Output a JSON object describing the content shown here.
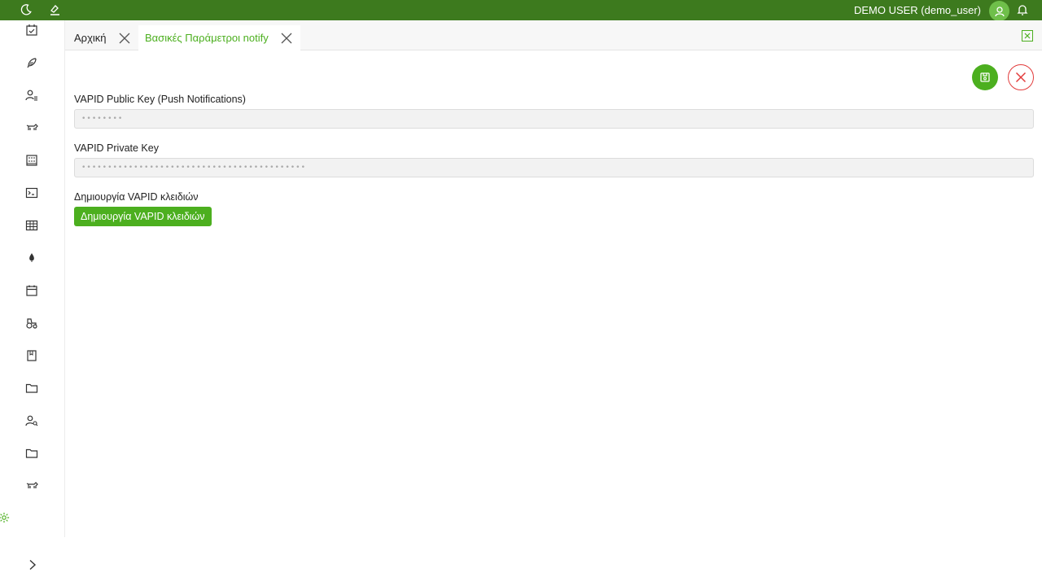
{
  "header": {
    "user_label": "DEMO USER (demo_user)",
    "icons": [
      "moon-icon",
      "brush-icon",
      "user-avatar-icon",
      "bell-icon"
    ]
  },
  "sidebar": {
    "items": [
      {
        "icon": "calendar-check-icon"
      },
      {
        "icon": "feather-icon"
      },
      {
        "icon": "user-list-icon"
      },
      {
        "icon": "cow-icon"
      },
      {
        "icon": "building-icon"
      },
      {
        "icon": "terminal-icon"
      },
      {
        "icon": "table-icon"
      },
      {
        "icon": "drop-icon"
      },
      {
        "icon": "calendar-icon"
      },
      {
        "icon": "tractor-icon"
      },
      {
        "icon": "book-icon"
      },
      {
        "icon": "folder-icon"
      },
      {
        "icon": "user-search-icon"
      },
      {
        "icon": "folder-icon"
      },
      {
        "icon": "cow-icon"
      }
    ],
    "settings_icon": "gear-icon",
    "expand_icon": "chevron-right-icon"
  },
  "tabs": [
    {
      "label": "Αρχική",
      "active": false
    },
    {
      "label": "Βασικές Παράμετροι notify",
      "active": true
    }
  ],
  "form": {
    "public_key_label": "VAPID Public Key (Push Notifications)",
    "public_key_value": "••••••••",
    "private_key_label": "VAPID Private Key",
    "private_key_value": "•••••••••••••••••••••••••••••••••••••••••••",
    "generate_label": "Δημιουργία VAPID κλειδιών",
    "generate_button": "Δημιουργία VAPID κλειδιών"
  },
  "colors": {
    "header_bg": "#3d7a1e",
    "accent": "#4caf1f",
    "danger": "#e23b3b"
  }
}
